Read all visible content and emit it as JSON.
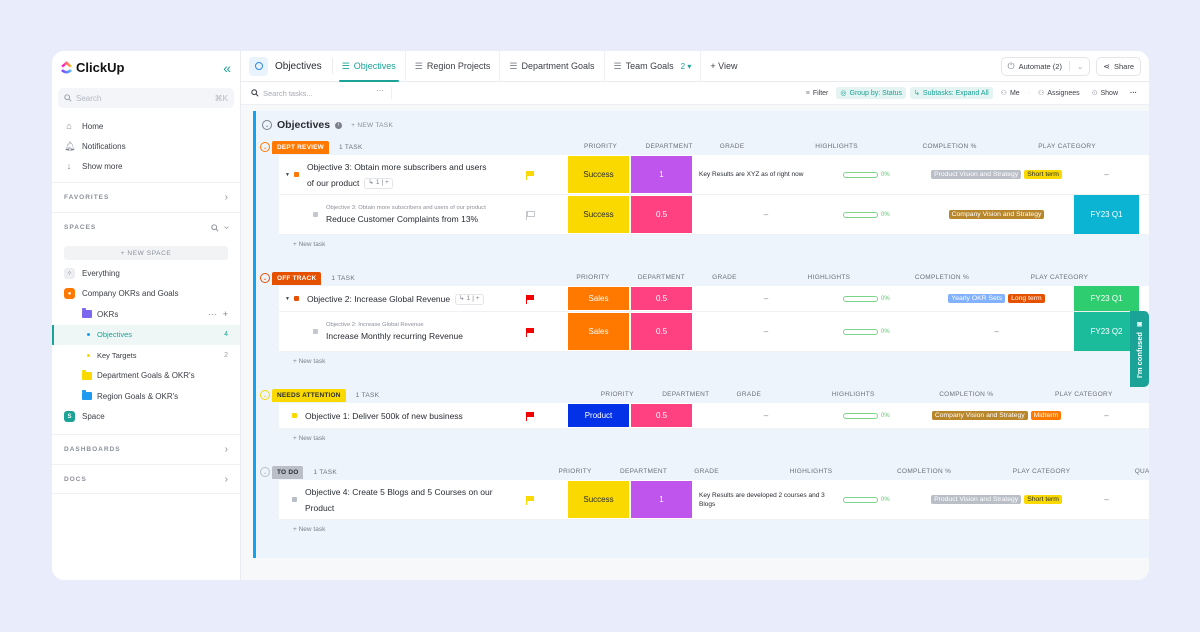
{
  "app": {
    "brand": "ClickUp"
  },
  "sidebar": {
    "search_placeholder": "Search",
    "search_shortcut": "⌘K",
    "nav": [
      {
        "label": "Home",
        "icon": "home-icon"
      },
      {
        "label": "Notifications",
        "icon": "bell-icon"
      },
      {
        "label": "Show more",
        "icon": "arrow-down-icon"
      }
    ],
    "favorites_label": "FAVORITES",
    "spaces_label": "SPACES",
    "new_space_label": "+ NEW SPACE",
    "tree": {
      "everything": "Everything",
      "company": "Company OKRs and Goals",
      "okrs": "OKRs",
      "objectives": "Objectives",
      "objectives_count": "4",
      "key_targets": "Key Targets",
      "key_targets_count": "2",
      "dept_goals": "Department Goals & OKR's",
      "region_goals": "Region Goals & OKR's",
      "space": "Space",
      "space_initial": "S"
    },
    "dashboards_label": "DASHBOARDS",
    "docs_label": "DOCS"
  },
  "topbar": {
    "page_title": "Objectives",
    "tabs": [
      {
        "label": "Objectives",
        "active": true
      },
      {
        "label": "Region Projects"
      },
      {
        "label": "Department Goals"
      },
      {
        "label": "Team Goals",
        "badge": "2"
      }
    ],
    "add_view": "+ View",
    "automate": "Automate (2)",
    "share": "Share"
  },
  "toolbar": {
    "search_placeholder": "Search tasks...",
    "filter": "Filter",
    "group_by": "Group by: Status",
    "subtasks": "Subtasks: Expand All",
    "me": "Me",
    "assignees": "Assignees",
    "show": "Show"
  },
  "list": {
    "title": "Objectives",
    "new_task": "+ NEW TASK",
    "columns": {
      "priority": "PRIORITY",
      "department": "DEPARTMENT",
      "grade": "GRADE",
      "highlights": "HIGHLIGHTS",
      "completion": "COMPLETION %",
      "play_category": "PLAY CATEGORY",
      "quarter": "QUARTER"
    },
    "new_task_row": "+ New task",
    "groups": [
      {
        "status": "DEPT REVIEW",
        "count": "1 TASK",
        "rows": [
          {
            "name": "Objective 3: Obtain more subscribers and users of our product",
            "subtasks": "1",
            "priority": "yellow",
            "department": "Success",
            "grade": "1",
            "highlights": "Key Results are XYZ as of right now",
            "completion": "0%",
            "tags": [
              {
                "label": "Product Vision and Strategy",
                "color": "#b9bec7"
              },
              {
                "label": "Short term",
                "color": "#f9d900"
              }
            ],
            "quarter": "–"
          },
          {
            "parent": "Objective 3: Obtain more subscribers and users of our product",
            "name": "Reduce Customer Complaints from 13%",
            "priority": "none",
            "department": "Success",
            "grade": "0.5",
            "highlights": "–",
            "completion": "0%",
            "tags": [
              {
                "label": "Company Vision and Strategy",
                "color": "#b8862b"
              }
            ],
            "quarter": "FY23 Q1"
          }
        ]
      },
      {
        "status": "OFF TRACK",
        "count": "1 TASK",
        "rows": [
          {
            "name": "Objective 2: Increase Global Revenue",
            "subtasks": "1",
            "priority": "red",
            "department": "Sales",
            "grade": "0.5",
            "highlights": "–",
            "completion": "0%",
            "tags": [
              {
                "label": "Yearly OKR Sets",
                "color": "#81b1ff"
              },
              {
                "label": "Long term",
                "color": "#e65100"
              }
            ],
            "quarter": "FY23 Q1"
          },
          {
            "parent": "Objective 2: Increase Global Revenue",
            "name": "Increase Monthly recurring Revenue",
            "priority": "red",
            "department": "Sales",
            "grade": "0.5",
            "highlights": "–",
            "completion": "0%",
            "tags": [],
            "play_dash": "–",
            "quarter": "FY23 Q2"
          }
        ]
      },
      {
        "status": "NEEDS ATTENTION",
        "count": "1 TASK",
        "rows": [
          {
            "name": "Objective 1: Deliver 500k of new business",
            "priority": "red",
            "department": "Product",
            "grade": "0.5",
            "highlights": "–",
            "completion": "0%",
            "tags": [
              {
                "label": "Company Vision and Strategy",
                "color": "#b8862b"
              },
              {
                "label": "Midterm",
                "color": "#ff7800"
              }
            ],
            "quarter": "–"
          }
        ]
      },
      {
        "status": "TO DO",
        "count": "1 TASK",
        "rows": [
          {
            "name": "Objective 4: Create 5 Blogs and 5 Courses on our Product",
            "priority": "yellow",
            "department": "Success",
            "grade": "1",
            "highlights": "Key Results are developed 2 courses and 3 Blogs",
            "completion": "0%",
            "tags": [
              {
                "label": "Product Vision and Strategy",
                "color": "#b9bec7"
              },
              {
                "label": "Short term",
                "color": "#f9d900"
              }
            ],
            "quarter": "–"
          }
        ]
      }
    ]
  },
  "feedback_tab": "I'm confused",
  "colors": {
    "accent": "#1aa396",
    "dept_review": "#ff7800",
    "off_track": "#e65100",
    "needs_attention": "#f9d900",
    "to_do": "#b9bec7",
    "success": "#f9d900",
    "sales": "#ff7800",
    "product": "#0231e8",
    "grade_1": "#bf55ec",
    "grade_05": "#ff4081",
    "q1_dept": "#0ab4d2",
    "q1_off": "#2ecd6f",
    "q2": "#1bbc9c"
  }
}
